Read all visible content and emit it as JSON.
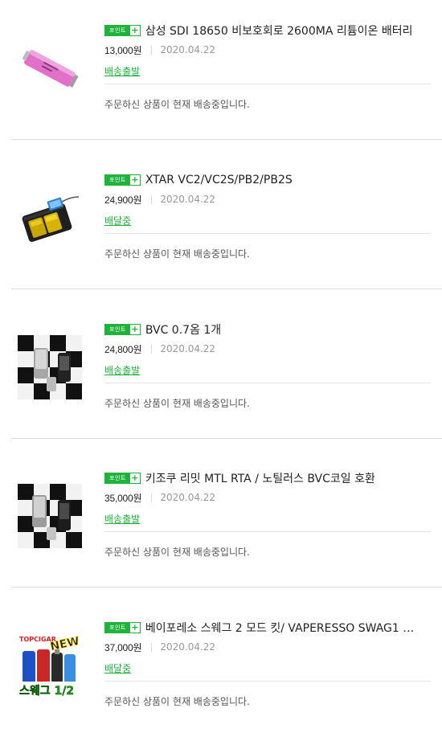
{
  "orders": [
    {
      "point_label": "포인트",
      "plus": "+",
      "title": "삼성 SDI 18650 비보호회로 2600MA 리튬이온 배터리",
      "price": "13,000원",
      "date": "2020.04.22",
      "status": "배송출발",
      "message": "주문하신 상품이 현재 배송중입니다.",
      "image": "pink-battery"
    },
    {
      "point_label": "포인트",
      "plus": "+",
      "title": "XTAR VC2/VC2S/PB2/PB2S",
      "price": "24,900원",
      "date": "2020.04.22",
      "status": "배달중",
      "message": "주문하신 상품이 현재 배송중입니다.",
      "image": "battery-charger"
    },
    {
      "point_label": "포인트",
      "plus": "+",
      "title": "BVC 0.7옴 1개",
      "price": "24,800원",
      "date": "2020.04.22",
      "status": "배송출발",
      "message": "주문하신 상품이 현재 배송중입니다.",
      "image": "atomizer-chessboard"
    },
    {
      "point_label": "포인트",
      "plus": "+",
      "title": "키조쿠 리밋 MTL RTA / 노틸러스 BVC코일 호환",
      "price": "35,000원",
      "date": "2020.04.22",
      "status": "배송출발",
      "message": "주문하신 상품이 현재 배송중입니다.",
      "image": "rta-chessboard"
    },
    {
      "point_label": "포인트",
      "plus": "+",
      "title": "베이포레소 스웨그 2 모드 킷/ VAPERESSO SWAG1 …",
      "price": "37,000원",
      "date": "2020.04.22",
      "status": "배달중",
      "message": "주문하신 상품이 현재 배송중입니다.",
      "image": "swag-kit",
      "image_text": {
        "brand": "TOPCIGAR",
        "badge": "NEW",
        "caption": "스웨그 1/2"
      }
    }
  ]
}
